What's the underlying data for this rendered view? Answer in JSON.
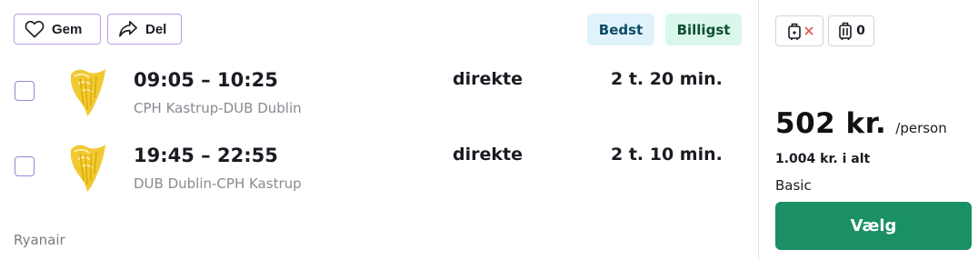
{
  "actions": {
    "save_label": "Gem",
    "share_label": "Del"
  },
  "badges": {
    "best": "Bedst",
    "cheapest": "Billigst"
  },
  "flights": [
    {
      "times": "09:05 – 10:25",
      "route": "CPH Kastrup-DUB Dublin",
      "stops": "direkte",
      "duration": "2 t. 20 min."
    },
    {
      "times": "19:45 – 22:55",
      "route": "DUB Dublin-CPH Kastrup",
      "stops": "direkte",
      "duration": "2 t. 10 min."
    }
  ],
  "airline": "Ryanair",
  "bags": {
    "carry_on_icon": "carry-on-bag-not-included-icon",
    "checked_icon": "checked-bag-icon",
    "checked_count": "0"
  },
  "pricing": {
    "amount": "502 kr.",
    "unit": "/person",
    "total": "1.004 kr. i alt",
    "fare_class": "Basic",
    "select_label": "Vælg"
  },
  "colors": {
    "accent_border": "#b99ce0",
    "select_button": "#1b9065",
    "badge_best_bg": "#e0f3fc",
    "badge_cheapest_bg": "#d9f7ea",
    "airline_logo": "#f1c933"
  }
}
